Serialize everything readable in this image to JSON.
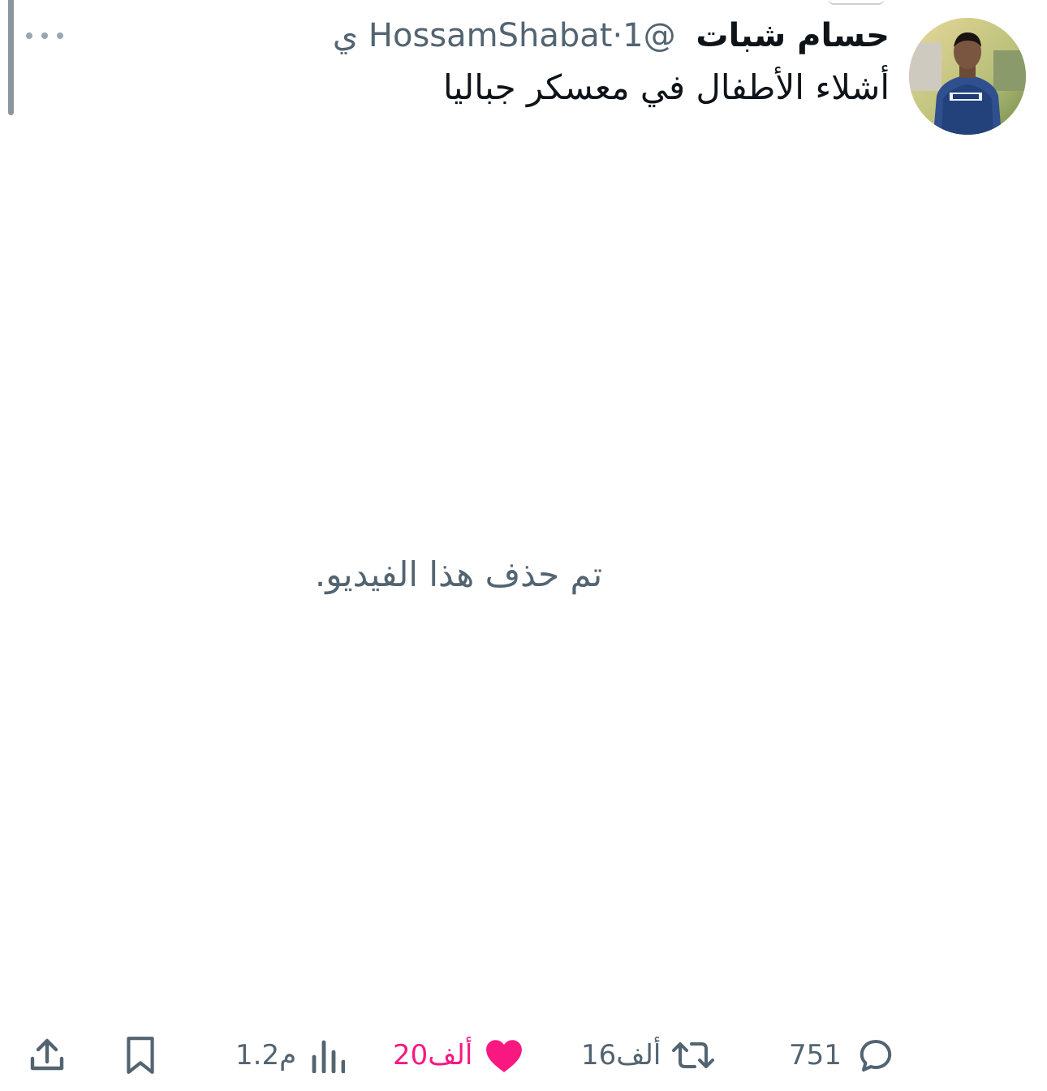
{
  "tweet": {
    "author_name": "حسام شبات",
    "handle": "@HossamShabat",
    "separator": "·",
    "time": "1 ي",
    "text": "أشلاء الأطفال في معسكر جباليا",
    "media_notice": "تم حذف هذا الفيديو."
  },
  "actions": {
    "replies": "751",
    "retweets": "16ألف",
    "likes": "20ألف",
    "views": "1.2م"
  },
  "icons": {
    "more": "more-horizontal-icon",
    "reply": "reply-icon",
    "retweet": "retweet-icon",
    "like": "heart-icon",
    "views": "views-icon",
    "bookmark": "bookmark-icon",
    "share": "share-icon"
  },
  "colors": {
    "like_active": "#f91880",
    "secondary_text": "#536471",
    "primary_text": "#0f1419"
  }
}
